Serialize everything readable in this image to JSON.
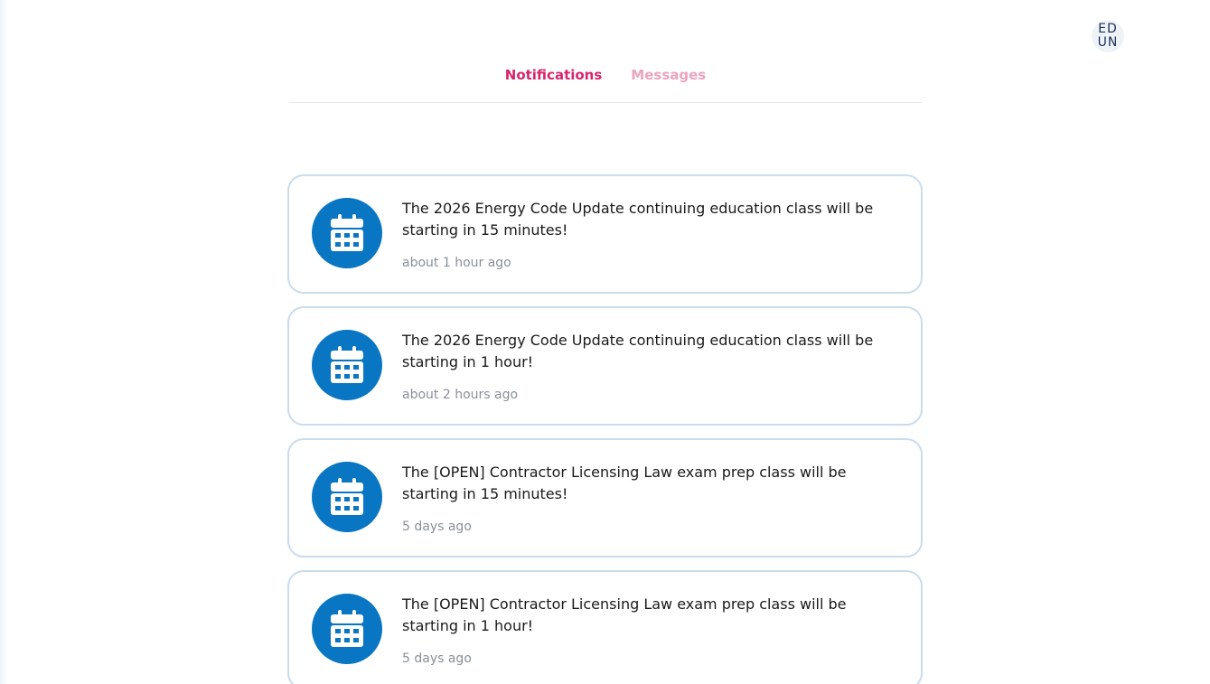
{
  "user": {
    "initials": "EDUN"
  },
  "tabs": [
    {
      "label": "Notifications",
      "active": true
    },
    {
      "label": "Messages",
      "active": false
    }
  ],
  "notifications": [
    {
      "icon": "calendar-icon",
      "text": "The 2026 Energy Code Update continuing education class will be starting in 15 minutes!",
      "time": "about 1 hour ago"
    },
    {
      "icon": "calendar-icon",
      "text": "The 2026 Energy Code Update continuing education class will be starting in 1 hour!",
      "time": "about 2 hours ago"
    },
    {
      "icon": "calendar-icon",
      "text": "The [OPEN] Contractor Licensing Law exam prep class will be starting in 15 minutes!",
      "time": "5 days ago"
    },
    {
      "icon": "calendar-icon",
      "text": "The [OPEN] Contractor Licensing Law exam prep class will be starting in 1 hour!",
      "time": "5 days ago"
    }
  ],
  "colors": {
    "accent": "#d4266e",
    "accent_inactive": "#eca3bf",
    "icon_bg": "#0876c2",
    "card_border": "#c9dcec"
  }
}
